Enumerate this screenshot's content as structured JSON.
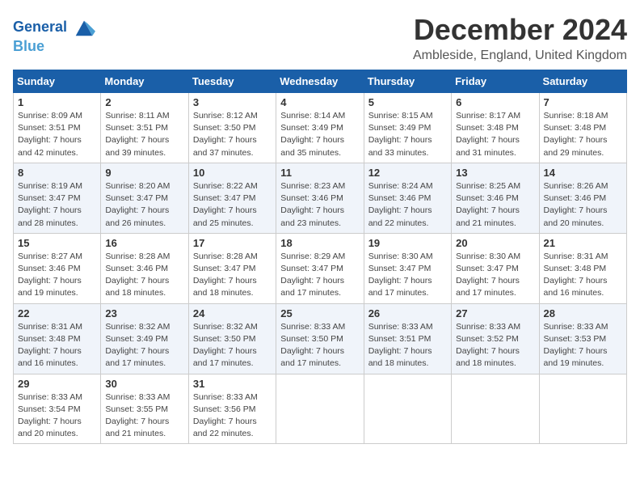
{
  "logo": {
    "line1": "General",
    "line2": "Blue"
  },
  "title": "December 2024",
  "subtitle": "Ambleside, England, United Kingdom",
  "weekdays": [
    "Sunday",
    "Monday",
    "Tuesday",
    "Wednesday",
    "Thursday",
    "Friday",
    "Saturday"
  ],
  "weeks": [
    [
      {
        "day": "1",
        "rise": "8:09 AM",
        "set": "3:51 PM",
        "daylight": "7 hours and 42 minutes."
      },
      {
        "day": "2",
        "rise": "8:11 AM",
        "set": "3:51 PM",
        "daylight": "7 hours and 39 minutes."
      },
      {
        "day": "3",
        "rise": "8:12 AM",
        "set": "3:50 PM",
        "daylight": "7 hours and 37 minutes."
      },
      {
        "day": "4",
        "rise": "8:14 AM",
        "set": "3:49 PM",
        "daylight": "7 hours and 35 minutes."
      },
      {
        "day": "5",
        "rise": "8:15 AM",
        "set": "3:49 PM",
        "daylight": "7 hours and 33 minutes."
      },
      {
        "day": "6",
        "rise": "8:17 AM",
        "set": "3:48 PM",
        "daylight": "7 hours and 31 minutes."
      },
      {
        "day": "7",
        "rise": "8:18 AM",
        "set": "3:48 PM",
        "daylight": "7 hours and 29 minutes."
      }
    ],
    [
      {
        "day": "8",
        "rise": "8:19 AM",
        "set": "3:47 PM",
        "daylight": "7 hours and 28 minutes."
      },
      {
        "day": "9",
        "rise": "8:20 AM",
        "set": "3:47 PM",
        "daylight": "7 hours and 26 minutes."
      },
      {
        "day": "10",
        "rise": "8:22 AM",
        "set": "3:47 PM",
        "daylight": "7 hours and 25 minutes."
      },
      {
        "day": "11",
        "rise": "8:23 AM",
        "set": "3:46 PM",
        "daylight": "7 hours and 23 minutes."
      },
      {
        "day": "12",
        "rise": "8:24 AM",
        "set": "3:46 PM",
        "daylight": "7 hours and 22 minutes."
      },
      {
        "day": "13",
        "rise": "8:25 AM",
        "set": "3:46 PM",
        "daylight": "7 hours and 21 minutes."
      },
      {
        "day": "14",
        "rise": "8:26 AM",
        "set": "3:46 PM",
        "daylight": "7 hours and 20 minutes."
      }
    ],
    [
      {
        "day": "15",
        "rise": "8:27 AM",
        "set": "3:46 PM",
        "daylight": "7 hours and 19 minutes."
      },
      {
        "day": "16",
        "rise": "8:28 AM",
        "set": "3:46 PM",
        "daylight": "7 hours and 18 minutes."
      },
      {
        "day": "17",
        "rise": "8:28 AM",
        "set": "3:47 PM",
        "daylight": "7 hours and 18 minutes."
      },
      {
        "day": "18",
        "rise": "8:29 AM",
        "set": "3:47 PM",
        "daylight": "7 hours and 17 minutes."
      },
      {
        "day": "19",
        "rise": "8:30 AM",
        "set": "3:47 PM",
        "daylight": "7 hours and 17 minutes."
      },
      {
        "day": "20",
        "rise": "8:30 AM",
        "set": "3:47 PM",
        "daylight": "7 hours and 17 minutes."
      },
      {
        "day": "21",
        "rise": "8:31 AM",
        "set": "3:48 PM",
        "daylight": "7 hours and 16 minutes."
      }
    ],
    [
      {
        "day": "22",
        "rise": "8:31 AM",
        "set": "3:48 PM",
        "daylight": "7 hours and 16 minutes."
      },
      {
        "day": "23",
        "rise": "8:32 AM",
        "set": "3:49 PM",
        "daylight": "7 hours and 17 minutes."
      },
      {
        "day": "24",
        "rise": "8:32 AM",
        "set": "3:50 PM",
        "daylight": "7 hours and 17 minutes."
      },
      {
        "day": "25",
        "rise": "8:33 AM",
        "set": "3:50 PM",
        "daylight": "7 hours and 17 minutes."
      },
      {
        "day": "26",
        "rise": "8:33 AM",
        "set": "3:51 PM",
        "daylight": "7 hours and 18 minutes."
      },
      {
        "day": "27",
        "rise": "8:33 AM",
        "set": "3:52 PM",
        "daylight": "7 hours and 18 minutes."
      },
      {
        "day": "28",
        "rise": "8:33 AM",
        "set": "3:53 PM",
        "daylight": "7 hours and 19 minutes."
      }
    ],
    [
      {
        "day": "29",
        "rise": "8:33 AM",
        "set": "3:54 PM",
        "daylight": "7 hours and 20 minutes."
      },
      {
        "day": "30",
        "rise": "8:33 AM",
        "set": "3:55 PM",
        "daylight": "7 hours and 21 minutes."
      },
      {
        "day": "31",
        "rise": "8:33 AM",
        "set": "3:56 PM",
        "daylight": "7 hours and 22 minutes."
      },
      null,
      null,
      null,
      null
    ]
  ],
  "labels": {
    "sunrise": "Sunrise:",
    "sunset": "Sunset:",
    "daylight": "Daylight:"
  }
}
